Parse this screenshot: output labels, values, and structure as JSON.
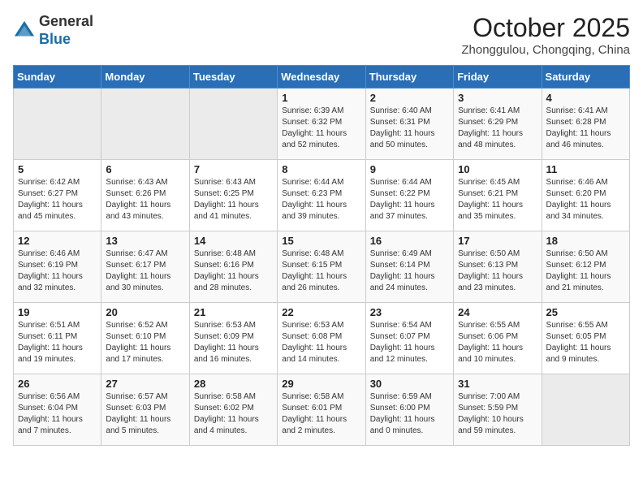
{
  "header": {
    "logo_general": "General",
    "logo_blue": "Blue",
    "title": "October 2025",
    "subtitle": "Zhonggulou, Chongqing, China"
  },
  "weekdays": [
    "Sunday",
    "Monday",
    "Tuesday",
    "Wednesday",
    "Thursday",
    "Friday",
    "Saturday"
  ],
  "weeks": [
    [
      {
        "day": "",
        "sunrise": "",
        "sunset": "",
        "daylight": ""
      },
      {
        "day": "",
        "sunrise": "",
        "sunset": "",
        "daylight": ""
      },
      {
        "day": "",
        "sunrise": "",
        "sunset": "",
        "daylight": ""
      },
      {
        "day": "1",
        "sunrise": "Sunrise: 6:39 AM",
        "sunset": "Sunset: 6:32 PM",
        "daylight": "Daylight: 11 hours and 52 minutes."
      },
      {
        "day": "2",
        "sunrise": "Sunrise: 6:40 AM",
        "sunset": "Sunset: 6:31 PM",
        "daylight": "Daylight: 11 hours and 50 minutes."
      },
      {
        "day": "3",
        "sunrise": "Sunrise: 6:41 AM",
        "sunset": "Sunset: 6:29 PM",
        "daylight": "Daylight: 11 hours and 48 minutes."
      },
      {
        "day": "4",
        "sunrise": "Sunrise: 6:41 AM",
        "sunset": "Sunset: 6:28 PM",
        "daylight": "Daylight: 11 hours and 46 minutes."
      }
    ],
    [
      {
        "day": "5",
        "sunrise": "Sunrise: 6:42 AM",
        "sunset": "Sunset: 6:27 PM",
        "daylight": "Daylight: 11 hours and 45 minutes."
      },
      {
        "day": "6",
        "sunrise": "Sunrise: 6:43 AM",
        "sunset": "Sunset: 6:26 PM",
        "daylight": "Daylight: 11 hours and 43 minutes."
      },
      {
        "day": "7",
        "sunrise": "Sunrise: 6:43 AM",
        "sunset": "Sunset: 6:25 PM",
        "daylight": "Daylight: 11 hours and 41 minutes."
      },
      {
        "day": "8",
        "sunrise": "Sunrise: 6:44 AM",
        "sunset": "Sunset: 6:23 PM",
        "daylight": "Daylight: 11 hours and 39 minutes."
      },
      {
        "day": "9",
        "sunrise": "Sunrise: 6:44 AM",
        "sunset": "Sunset: 6:22 PM",
        "daylight": "Daylight: 11 hours and 37 minutes."
      },
      {
        "day": "10",
        "sunrise": "Sunrise: 6:45 AM",
        "sunset": "Sunset: 6:21 PM",
        "daylight": "Daylight: 11 hours and 35 minutes."
      },
      {
        "day": "11",
        "sunrise": "Sunrise: 6:46 AM",
        "sunset": "Sunset: 6:20 PM",
        "daylight": "Daylight: 11 hours and 34 minutes."
      }
    ],
    [
      {
        "day": "12",
        "sunrise": "Sunrise: 6:46 AM",
        "sunset": "Sunset: 6:19 PM",
        "daylight": "Daylight: 11 hours and 32 minutes."
      },
      {
        "day": "13",
        "sunrise": "Sunrise: 6:47 AM",
        "sunset": "Sunset: 6:17 PM",
        "daylight": "Daylight: 11 hours and 30 minutes."
      },
      {
        "day": "14",
        "sunrise": "Sunrise: 6:48 AM",
        "sunset": "Sunset: 6:16 PM",
        "daylight": "Daylight: 11 hours and 28 minutes."
      },
      {
        "day": "15",
        "sunrise": "Sunrise: 6:48 AM",
        "sunset": "Sunset: 6:15 PM",
        "daylight": "Daylight: 11 hours and 26 minutes."
      },
      {
        "day": "16",
        "sunrise": "Sunrise: 6:49 AM",
        "sunset": "Sunset: 6:14 PM",
        "daylight": "Daylight: 11 hours and 24 minutes."
      },
      {
        "day": "17",
        "sunrise": "Sunrise: 6:50 AM",
        "sunset": "Sunset: 6:13 PM",
        "daylight": "Daylight: 11 hours and 23 minutes."
      },
      {
        "day": "18",
        "sunrise": "Sunrise: 6:50 AM",
        "sunset": "Sunset: 6:12 PM",
        "daylight": "Daylight: 11 hours and 21 minutes."
      }
    ],
    [
      {
        "day": "19",
        "sunrise": "Sunrise: 6:51 AM",
        "sunset": "Sunset: 6:11 PM",
        "daylight": "Daylight: 11 hours and 19 minutes."
      },
      {
        "day": "20",
        "sunrise": "Sunrise: 6:52 AM",
        "sunset": "Sunset: 6:10 PM",
        "daylight": "Daylight: 11 hours and 17 minutes."
      },
      {
        "day": "21",
        "sunrise": "Sunrise: 6:53 AM",
        "sunset": "Sunset: 6:09 PM",
        "daylight": "Daylight: 11 hours and 16 minutes."
      },
      {
        "day": "22",
        "sunrise": "Sunrise: 6:53 AM",
        "sunset": "Sunset: 6:08 PM",
        "daylight": "Daylight: 11 hours and 14 minutes."
      },
      {
        "day": "23",
        "sunrise": "Sunrise: 6:54 AM",
        "sunset": "Sunset: 6:07 PM",
        "daylight": "Daylight: 11 hours and 12 minutes."
      },
      {
        "day": "24",
        "sunrise": "Sunrise: 6:55 AM",
        "sunset": "Sunset: 6:06 PM",
        "daylight": "Daylight: 11 hours and 10 minutes."
      },
      {
        "day": "25",
        "sunrise": "Sunrise: 6:55 AM",
        "sunset": "Sunset: 6:05 PM",
        "daylight": "Daylight: 11 hours and 9 minutes."
      }
    ],
    [
      {
        "day": "26",
        "sunrise": "Sunrise: 6:56 AM",
        "sunset": "Sunset: 6:04 PM",
        "daylight": "Daylight: 11 hours and 7 minutes."
      },
      {
        "day": "27",
        "sunrise": "Sunrise: 6:57 AM",
        "sunset": "Sunset: 6:03 PM",
        "daylight": "Daylight: 11 hours and 5 minutes."
      },
      {
        "day": "28",
        "sunrise": "Sunrise: 6:58 AM",
        "sunset": "Sunset: 6:02 PM",
        "daylight": "Daylight: 11 hours and 4 minutes."
      },
      {
        "day": "29",
        "sunrise": "Sunrise: 6:58 AM",
        "sunset": "Sunset: 6:01 PM",
        "daylight": "Daylight: 11 hours and 2 minutes."
      },
      {
        "day": "30",
        "sunrise": "Sunrise: 6:59 AM",
        "sunset": "Sunset: 6:00 PM",
        "daylight": "Daylight: 11 hours and 0 minutes."
      },
      {
        "day": "31",
        "sunrise": "Sunrise: 7:00 AM",
        "sunset": "Sunset: 5:59 PM",
        "daylight": "Daylight: 10 hours and 59 minutes."
      },
      {
        "day": "",
        "sunrise": "",
        "sunset": "",
        "daylight": ""
      }
    ]
  ]
}
